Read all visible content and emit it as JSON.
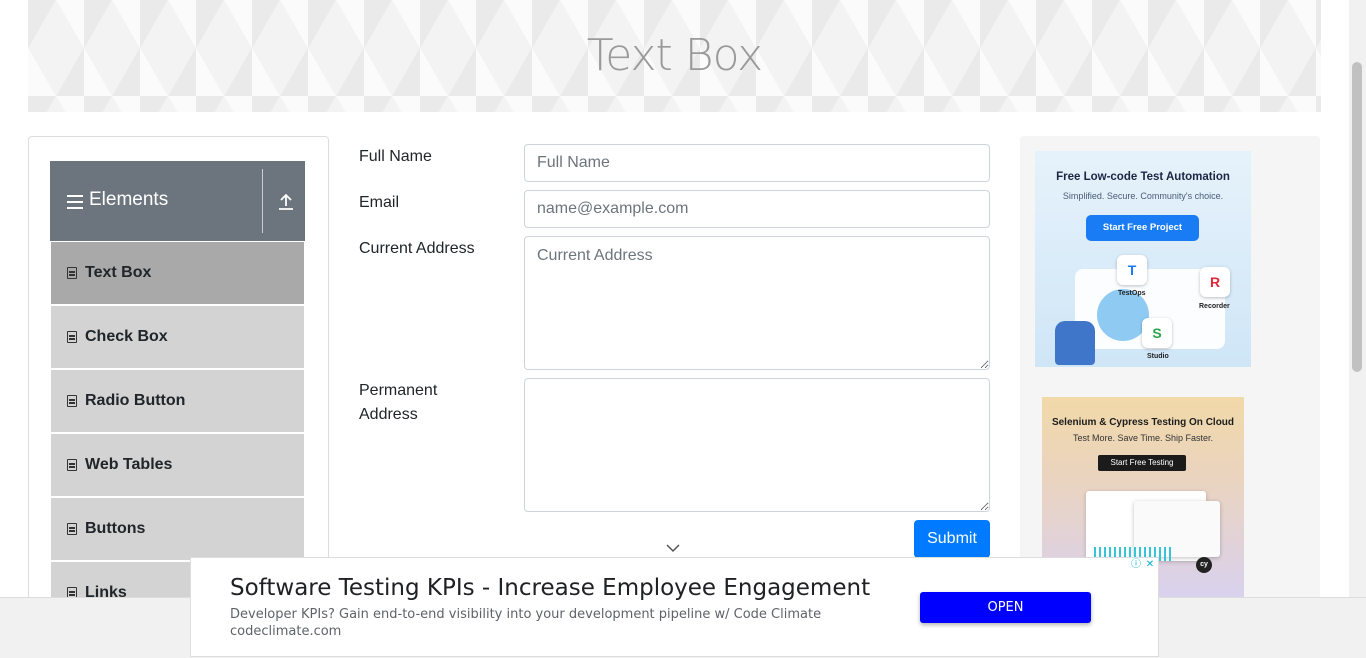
{
  "page": {
    "title": "Text Box"
  },
  "sidebar": {
    "group_title": "Elements",
    "items": [
      {
        "label": "Text Box",
        "active": true
      },
      {
        "label": "Check Box"
      },
      {
        "label": "Radio Button"
      },
      {
        "label": "Web Tables"
      },
      {
        "label": "Buttons"
      },
      {
        "label": "Links"
      }
    ]
  },
  "form": {
    "full_name": {
      "label": "Full Name",
      "placeholder": "Full Name",
      "value": ""
    },
    "email": {
      "label": "Email",
      "placeholder": "name@example.com",
      "value": ""
    },
    "current_address": {
      "label": "Current Address",
      "placeholder": "Current Address",
      "value": ""
    },
    "permanent_address": {
      "label_line1": "Permanent",
      "label_line2": "Address",
      "placeholder": "",
      "value": ""
    },
    "submit_label": "Submit"
  },
  "ads": {
    "ad1": {
      "headline": "Free Low-code Test Automation",
      "subline": "Simplified. Secure. Community's choice.",
      "button": "Start Free Project",
      "tile_labels": [
        "TestOps",
        "Recorder",
        "Studio"
      ]
    },
    "ad2": {
      "headline": "Selenium & Cypress Testing On Cloud",
      "subline": "Test More. Save Time. Ship Faster.",
      "button": "Start Free Testing",
      "badge": "cy"
    },
    "bottom": {
      "headline": "Software Testing KPIs - Increase Employee Engagement",
      "description": "Developer KPIs? Gain end-to-end visibility into your development pipeline w/ Code Climate",
      "domain": "codeclimate.com",
      "button": "OPEN"
    }
  },
  "colors": {
    "primary": "#007bff",
    "sidebar_header": "#6c757d",
    "menu_item": "#d3d3d3",
    "menu_active": "#a9a9a9",
    "ad_button": "#0000ff"
  }
}
